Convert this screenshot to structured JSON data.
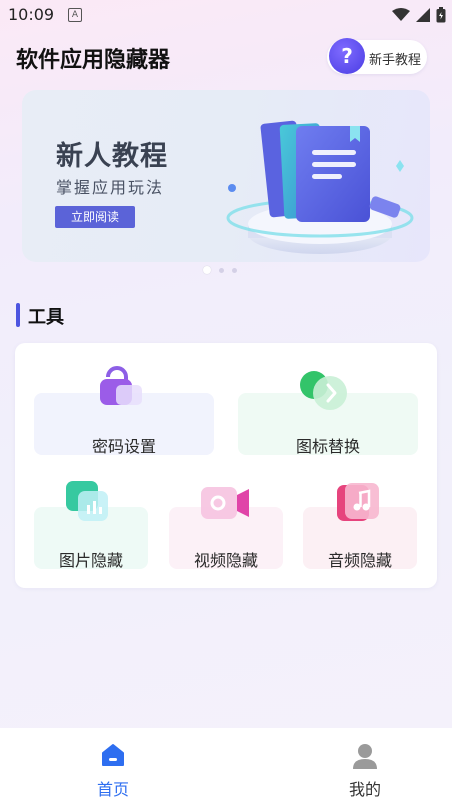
{
  "status_bar": {
    "time": "10:09",
    "notification_glyph": "A"
  },
  "header": {
    "title": "软件应用隐藏器",
    "tutorial_button": "新手教程",
    "tutorial_icon_glyph": "?"
  },
  "banner": {
    "title": "新人教程",
    "subtitle": "掌握应用玩法",
    "button": "立即阅读"
  },
  "carousel": {
    "pages": 3,
    "active": 0
  },
  "tools": {
    "section_title": "工具",
    "items": [
      {
        "label": "密码设置",
        "icon": "lock-icon"
      },
      {
        "label": "图标替换",
        "icon": "swap-arrow-icon"
      },
      {
        "label": "图片隐藏",
        "icon": "image-chart-icon"
      },
      {
        "label": "视频隐藏",
        "icon": "video-camera-icon"
      },
      {
        "label": "音频隐藏",
        "icon": "music-note-icon"
      }
    ]
  },
  "bottom_nav": {
    "items": [
      {
        "label": "首页",
        "icon": "home-icon",
        "active": true
      },
      {
        "label": "我的",
        "icon": "user-icon",
        "active": false
      }
    ]
  },
  "colors": {
    "accent": "#4d55e0",
    "active_nav": "#2e6ef0",
    "inactive_nav": "#333333"
  }
}
